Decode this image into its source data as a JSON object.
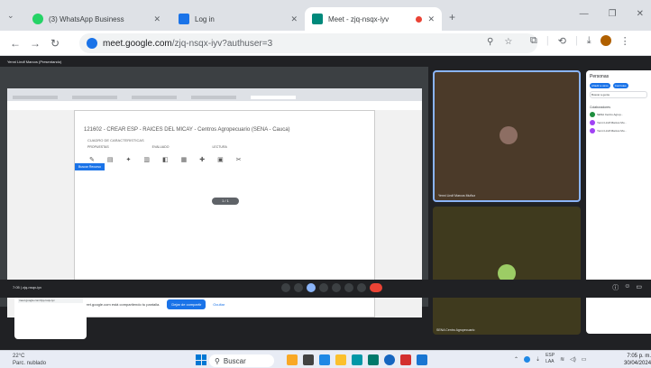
{
  "browser": {
    "tabs": [
      {
        "label": "(3) WhatsApp Business",
        "icon": "whatsapp-icon",
        "color": "#25d366"
      },
      {
        "label": "Log in",
        "icon": "google-icon",
        "color": "#1a73e8"
      },
      {
        "label": "Meet - zjq-nsqx-iyv",
        "icon": "meet-icon",
        "color": "#00897b"
      }
    ],
    "new_tab_label": "+",
    "url_host": "meet.google.com",
    "url_path": "/zjq-nsqx-iyv?authuser=3"
  },
  "meet": {
    "presenter_label": "Yenni Lindf Marcos (Presentando)",
    "shared_doc": {
      "title": "121602 - CREAR ESP - RAICES DEL MICAY - Centros Agropecuario (SENA - Cauca)",
      "subtitle": "CUADRO DE CARACTERISTICAS",
      "cols": [
        "PROPUESTAS",
        "EVALUADO",
        "LECTURA"
      ],
      "hint": "Buscar Recurso",
      "page_pill": "1 / 1",
      "share_text": "meet.google.com está compartiendo tu pantalla.",
      "share_button": "Dejar de compartir",
      "hide_button": "Ocultar"
    },
    "mini_popup": {
      "title": "¿La reunión está lista?",
      "add_button": "Añadir a otros",
      "link": "meet.google.com/zjq-nsqx-iyv"
    },
    "tile1_name": "Yenni Lindf Marcos Muñoz",
    "tile2_name": "SENA Centro Agropecuario",
    "meeting_code": "7:05 | zjq-nsqx-iyv"
  },
  "people": {
    "title": "Personas",
    "add_button": "Añadir a otros",
    "host_button": "Controles",
    "search_placeholder": "Buscar a gente",
    "section": "Colaboradores",
    "items": [
      "SENA Centro Agrop...",
      "Yenni Lindf Marcos Mu...",
      "Yenni Lindf Marcos Mu..."
    ]
  },
  "taskbar": {
    "weather_temp": "22°C",
    "weather_desc": "Parc. nublado",
    "search_label": "Buscar",
    "lang_top": "ESP",
    "lang_bottom": "LAA",
    "time": "7:05 p. m.",
    "date": "30/04/2024"
  }
}
